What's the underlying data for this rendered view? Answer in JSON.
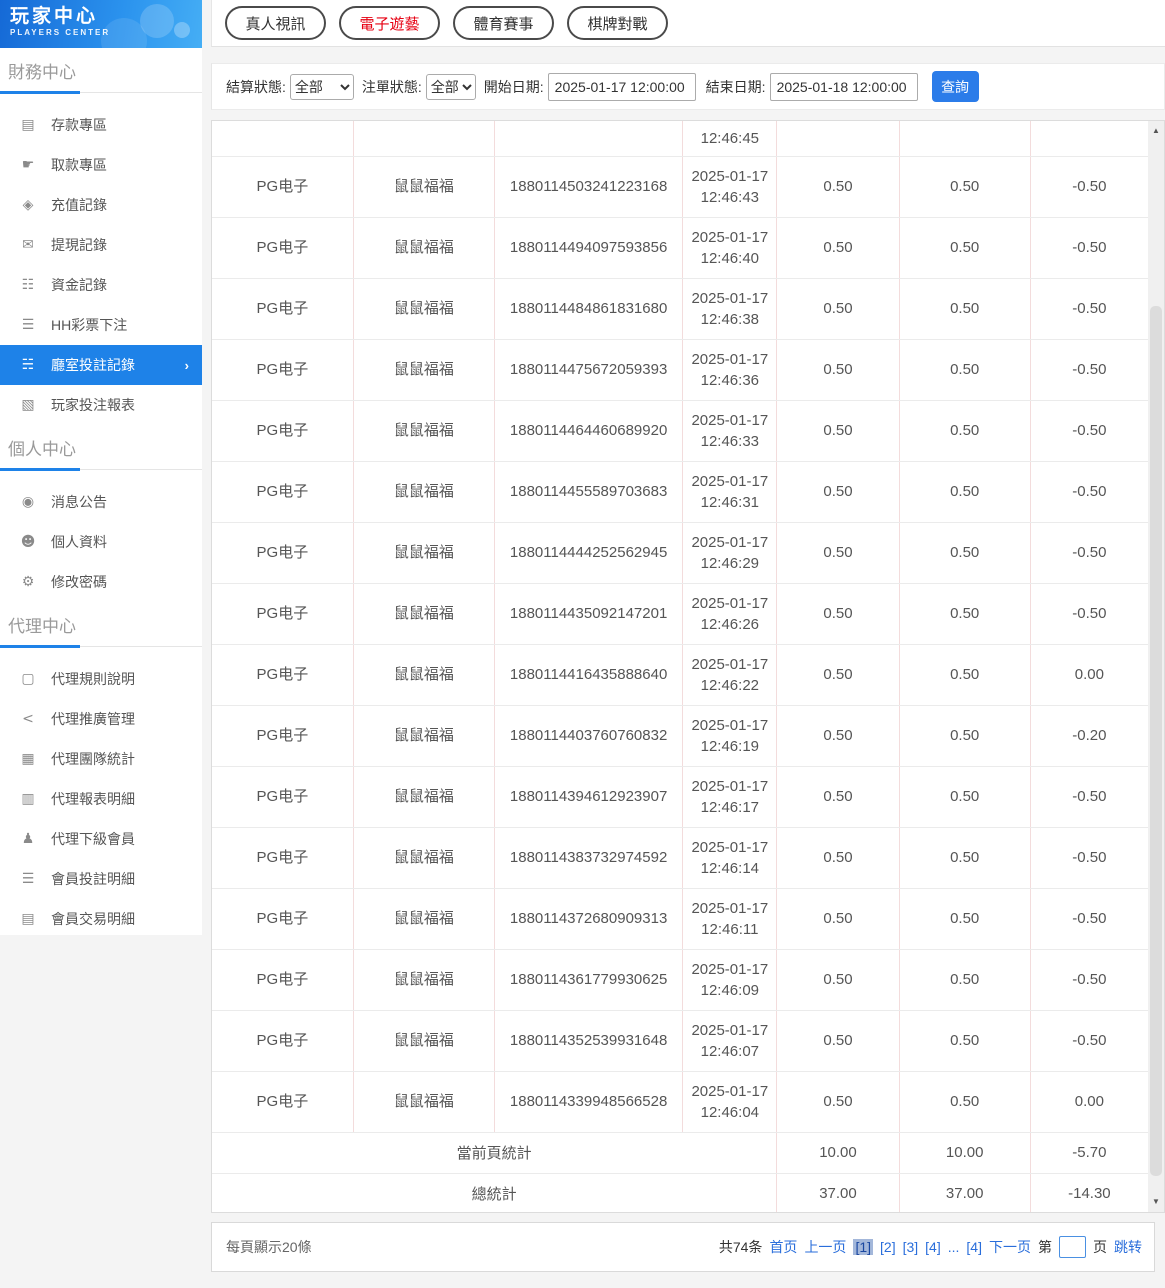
{
  "sidebar": {
    "logo": {
      "title": "玩家中心",
      "subtitle": "PLAYERS CENTER"
    },
    "sections": [
      {
        "label": "財務中心",
        "items": [
          {
            "icon": "deposit-icon",
            "glyph": "▤",
            "label": "存款專區",
            "active": false
          },
          {
            "icon": "withdraw-icon",
            "glyph": "☛",
            "label": "取款專區",
            "active": false
          },
          {
            "icon": "recharge-record-icon",
            "glyph": "◈",
            "label": "充值記錄",
            "active": false
          },
          {
            "icon": "withdrawal-record-icon",
            "glyph": "✉",
            "label": "提現記錄",
            "active": false
          },
          {
            "icon": "funds-record-icon",
            "glyph": "☷",
            "label": "資金記錄",
            "active": false
          },
          {
            "icon": "lottery-bet-icon",
            "glyph": "☰",
            "label": "HH彩票下注",
            "active": false
          },
          {
            "icon": "hall-bet-record-icon",
            "glyph": "☵",
            "label": "廳室投註記錄",
            "active": true
          },
          {
            "icon": "player-bet-report-icon",
            "glyph": "▧",
            "label": "玩家投注報表",
            "active": false
          }
        ]
      },
      {
        "label": "個人中心",
        "items": [
          {
            "icon": "bell-icon",
            "glyph": "◉",
            "label": "消息公告",
            "active": false
          },
          {
            "icon": "person-icon",
            "glyph": "☻",
            "label": "個人資料",
            "active": false
          },
          {
            "icon": "gear-icon",
            "glyph": "⚙",
            "label": "修改密碼",
            "active": false
          }
        ]
      },
      {
        "label": "代理中心",
        "items": [
          {
            "icon": "document-icon",
            "glyph": "▢",
            "label": "代理規則說明",
            "active": false
          },
          {
            "icon": "share-icon",
            "glyph": "<",
            "label": "代理推廣管理",
            "active": false
          },
          {
            "icon": "team-stats-icon",
            "glyph": "▦",
            "label": "代理團隊統計",
            "active": false
          },
          {
            "icon": "report-detail-icon",
            "glyph": "▥",
            "label": "代理報表明細",
            "active": false
          },
          {
            "icon": "users-icon",
            "glyph": "♟",
            "label": "代理下級會員",
            "active": false
          },
          {
            "icon": "member-bet-icon",
            "glyph": "☰",
            "label": "會員投註明細",
            "active": false
          },
          {
            "icon": "member-trade-icon",
            "glyph": "▤",
            "label": "會員交易明細",
            "active": false
          }
        ]
      }
    ]
  },
  "tabs": [
    {
      "label": "真人視訊",
      "active": false
    },
    {
      "label": "電子遊藝",
      "active": true
    },
    {
      "label": "體育賽事",
      "active": false
    },
    {
      "label": "棋牌對戰",
      "active": false
    }
  ],
  "filters": {
    "settle_status_label": "結算狀態:",
    "settle_status_value": "全部",
    "order_status_label": "注單狀態:",
    "order_status_value": "全部",
    "start_date_label": "開始日期:",
    "start_date_value": "2025-01-17 12:00:00",
    "end_date_label": "結束日期:",
    "end_date_value": "2025-01-18 12:00:00",
    "search_button": "查詢"
  },
  "table": {
    "partial_top_time": "12:46:45",
    "rows": [
      [
        "PG电子",
        "鼠鼠福福",
        "1880114503241223168",
        "2025-01-17 12:46:43",
        "0.50",
        "0.50",
        "-0.50"
      ],
      [
        "PG电子",
        "鼠鼠福福",
        "1880114494097593856",
        "2025-01-17 12:46:40",
        "0.50",
        "0.50",
        "-0.50"
      ],
      [
        "PG电子",
        "鼠鼠福福",
        "1880114484861831680",
        "2025-01-17 12:46:38",
        "0.50",
        "0.50",
        "-0.50"
      ],
      [
        "PG电子",
        "鼠鼠福福",
        "1880114475672059393",
        "2025-01-17 12:46:36",
        "0.50",
        "0.50",
        "-0.50"
      ],
      [
        "PG电子",
        "鼠鼠福福",
        "1880114464460689920",
        "2025-01-17 12:46:33",
        "0.50",
        "0.50",
        "-0.50"
      ],
      [
        "PG电子",
        "鼠鼠福福",
        "1880114455589703683",
        "2025-01-17 12:46:31",
        "0.50",
        "0.50",
        "-0.50"
      ],
      [
        "PG电子",
        "鼠鼠福福",
        "1880114444252562945",
        "2025-01-17 12:46:29",
        "0.50",
        "0.50",
        "-0.50"
      ],
      [
        "PG电子",
        "鼠鼠福福",
        "1880114435092147201",
        "2025-01-17 12:46:26",
        "0.50",
        "0.50",
        "-0.50"
      ],
      [
        "PG电子",
        "鼠鼠福福",
        "1880114416435888640",
        "2025-01-17 12:46:22",
        "0.50",
        "0.50",
        "0.00"
      ],
      [
        "PG电子",
        "鼠鼠福福",
        "1880114403760760832",
        "2025-01-17 12:46:19",
        "0.50",
        "0.50",
        "-0.20"
      ],
      [
        "PG电子",
        "鼠鼠福福",
        "1880114394612923907",
        "2025-01-17 12:46:17",
        "0.50",
        "0.50",
        "-0.50"
      ],
      [
        "PG电子",
        "鼠鼠福福",
        "1880114383732974592",
        "2025-01-17 12:46:14",
        "0.50",
        "0.50",
        "-0.50"
      ],
      [
        "PG电子",
        "鼠鼠福福",
        "1880114372680909313",
        "2025-01-17 12:46:11",
        "0.50",
        "0.50",
        "-0.50"
      ],
      [
        "PG电子",
        "鼠鼠福福",
        "1880114361779930625",
        "2025-01-17 12:46:09",
        "0.50",
        "0.50",
        "-0.50"
      ],
      [
        "PG电子",
        "鼠鼠福福",
        "1880114352539931648",
        "2025-01-17 12:46:07",
        "0.50",
        "0.50",
        "-0.50"
      ],
      [
        "PG电子",
        "鼠鼠福福",
        "1880114339948566528",
        "2025-01-17 12:46:04",
        "0.50",
        "0.50",
        "0.00"
      ]
    ],
    "summary": [
      {
        "label": "當前頁統計",
        "bet": "10.00",
        "valid": "10.00",
        "winloss": "-5.70"
      },
      {
        "label": "總統計",
        "bet": "37.00",
        "valid": "37.00",
        "winloss": "-14.30"
      }
    ]
  },
  "pagination": {
    "per_page": "每頁顯示20條",
    "items": [
      {
        "type": "text",
        "name": "total-count",
        "label": "共74条"
      },
      {
        "type": "link",
        "name": "first-page-link",
        "label": "首页"
      },
      {
        "type": "link",
        "name": "prev-page-link",
        "label": "上一页"
      },
      {
        "type": "current",
        "name": "page-1-current",
        "label": "[1]"
      },
      {
        "type": "link",
        "name": "page-2-link",
        "label": "[2]"
      },
      {
        "type": "link",
        "name": "page-3-link",
        "label": "[3]"
      },
      {
        "type": "link",
        "name": "page-4-link",
        "label": "[4]"
      },
      {
        "type": "link",
        "name": "ellipsis-link",
        "label": "..."
      },
      {
        "type": "link",
        "name": "last-page-link",
        "label": "[4]"
      },
      {
        "type": "link",
        "name": "next-page-link",
        "label": "下一页"
      },
      {
        "type": "text",
        "name": "jump-prefix",
        "label": "第"
      },
      {
        "type": "input",
        "name": "jump-page-input",
        "value": ""
      },
      {
        "type": "text",
        "name": "jump-suffix",
        "label": "页"
      },
      {
        "type": "link",
        "name": "jump-button",
        "label": "跳转"
      }
    ]
  },
  "colors": {
    "accent_blue": "#1e82e8",
    "button_blue": "#2b7ce9",
    "link_blue": "#2a6edb",
    "active_tab_red": "#e60012",
    "table_vertical_border": "#f3dcdc"
  }
}
